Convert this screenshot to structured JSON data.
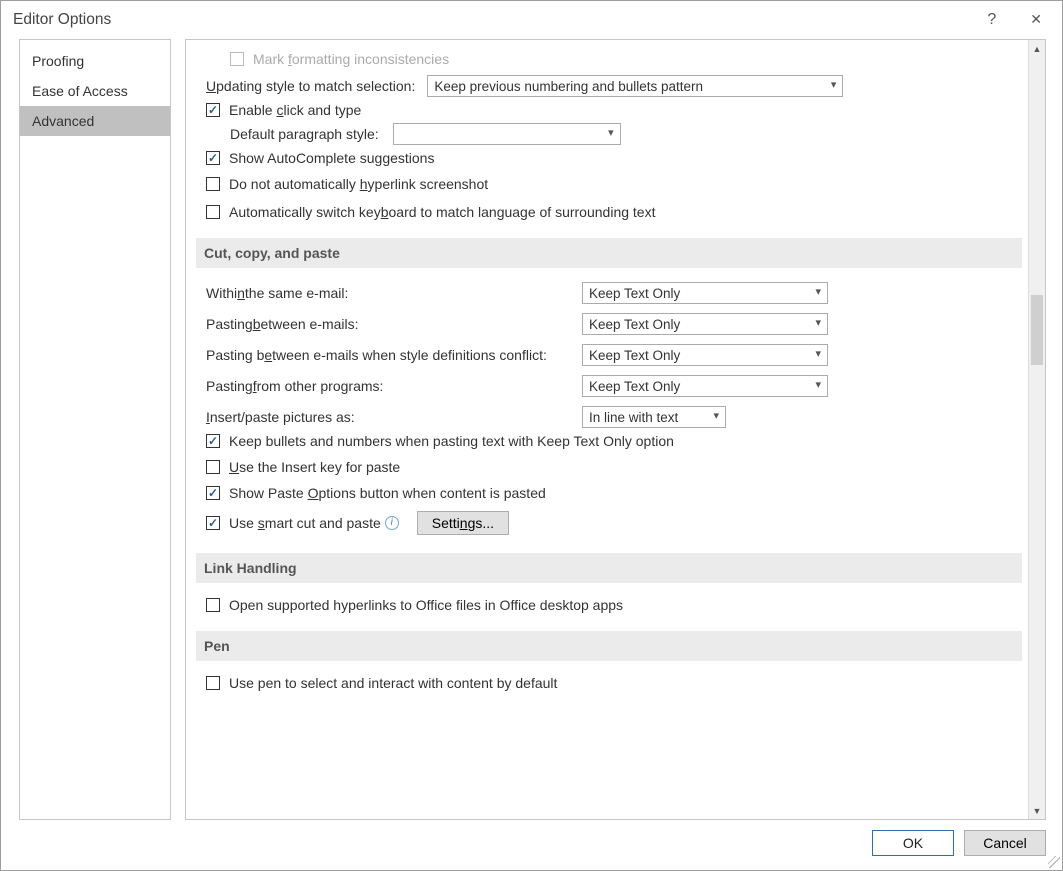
{
  "title": "Editor Options",
  "sidebar": {
    "items": [
      {
        "label": "Proofing"
      },
      {
        "label": "Ease of Access"
      },
      {
        "label": "Advanced"
      }
    ]
  },
  "editing": {
    "mark_inconsistencies": "Mark formatting inconsistencies",
    "updating_style_label": "Updating style to match selection:",
    "updating_style_value": "Keep previous numbering and bullets pattern",
    "enable_click_type": "Enable click and type",
    "default_para_style_label": "Default paragraph style:",
    "default_para_style_value": "",
    "show_autocomplete": "Show AutoComplete suggestions",
    "no_auto_hyperlink": "Do not automatically hyperlink screenshot",
    "auto_switch_keyboard": "Automatically switch keyboard to match language of surrounding text"
  },
  "sec_cut": "Cut, copy, and paste",
  "paste": {
    "within_label": "Within the same e-mail:",
    "between_label": "Pasting between e-mails:",
    "conflict_label": "Pasting between e-mails when style definitions conflict:",
    "other_label": "Pasting from other programs:",
    "insert_pic_label": "Insert/paste pictures as:",
    "keep_text_only": "Keep Text Only",
    "inline_text": "In line with text",
    "keep_bullets": "Keep bullets and numbers when pasting text with Keep Text Only option",
    "use_insert_key": "Use the Insert key for paste",
    "show_paste_options": "Show Paste Options button when content is pasted",
    "smart_cut": "Use smart cut and paste",
    "settings_btn": "Settings..."
  },
  "sec_link": "Link Handling",
  "link": {
    "open_supported": "Open supported hyperlinks to Office files in Office desktop apps"
  },
  "sec_pen": "Pen",
  "pen": {
    "use_pen": "Use pen to select and interact with content by default"
  },
  "footer": {
    "ok": "OK",
    "cancel": "Cancel"
  }
}
